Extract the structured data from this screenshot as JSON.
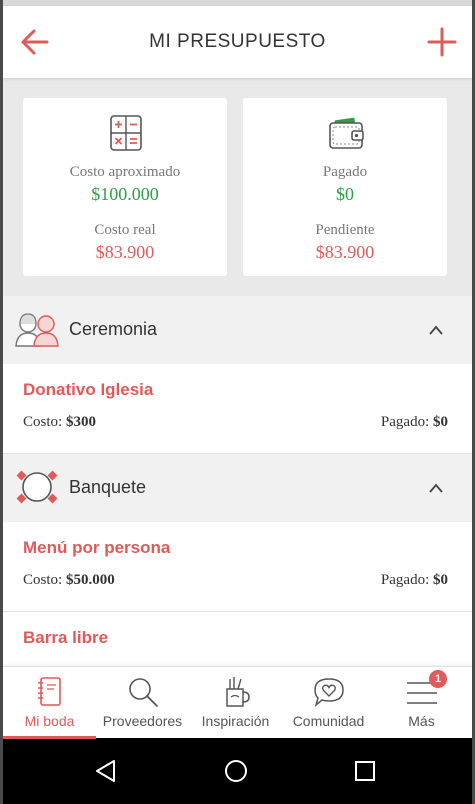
{
  "header": {
    "title": "MI PRESUPUESTO",
    "back_icon": "arrow-left-icon",
    "add_icon": "plus-icon"
  },
  "summary": {
    "estimate_card": {
      "icon": "calculator-icon",
      "approx_label": "Costo aproximado",
      "approx_value": "$100.000",
      "real_label": "Costo real",
      "real_value": "$83.900"
    },
    "payment_card": {
      "icon": "wallet-icon",
      "paid_label": "Pagado",
      "paid_value": "$0",
      "pending_label": "Pendiente",
      "pending_value": "$83.900"
    }
  },
  "sections": [
    {
      "title": "Ceremonia",
      "icon": "couple-icon",
      "items": [
        {
          "name": "Donativo Iglesia",
          "cost_label": "Costo:",
          "cost": "$300",
          "paid_label": "Pagado:",
          "paid": "$0"
        }
      ]
    },
    {
      "title": "Banquete",
      "icon": "table-icon",
      "items": [
        {
          "name": "Menú por persona",
          "cost_label": "Costo:",
          "cost": "$50.000",
          "paid_label": "Pagado:",
          "paid": "$0"
        },
        {
          "name": "Barra libre"
        }
      ]
    }
  ],
  "bottom_nav": {
    "items": [
      {
        "label": "Mi boda",
        "icon": "notebook-icon",
        "active": true
      },
      {
        "label": "Proveedores",
        "icon": "search-icon"
      },
      {
        "label": "Inspiración",
        "icon": "inspiration-icon"
      },
      {
        "label": "Comunidad",
        "icon": "chat-heart-icon"
      },
      {
        "label": "Más",
        "icon": "menu-icon",
        "badge": "1"
      }
    ]
  },
  "colors": {
    "accent": "#e05a5a",
    "green": "#2e9e44",
    "section_bg": "#f1f1f1",
    "summary_bg": "#e9e9e9"
  }
}
